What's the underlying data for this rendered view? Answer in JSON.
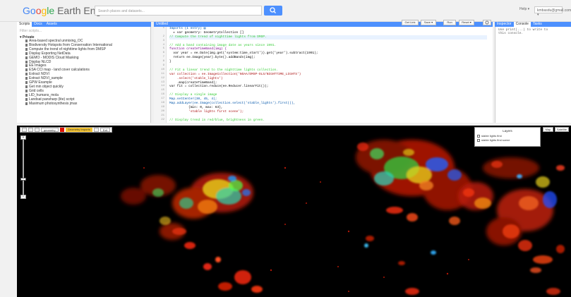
{
  "header": {
    "logo_g1": "Go",
    "logo_g2": "o",
    "logo_g3": "g",
    "logo_g4": "le",
    "logo_rest": " Earth Engine",
    "search_placeholder": "Search places and datasets...",
    "help": "Help ▾",
    "user": "kmbasdu@gmail.com ▾"
  },
  "left_panel": {
    "tabs": [
      "Scripts",
      "Docs",
      "Assets"
    ],
    "filter": "Filter scripts...",
    "folder": "▾ Private",
    "files": [
      "Area-based spectral unmixing_OC",
      "Biodiversity Hotspots from Conservation International",
      "Compute the trend of nighttime lights from DMSP",
      "Display Exporting NetData",
      "GEMO - MODIS Cloud Masking",
      "Display NLCD",
      "EE Images",
      "ESA CCI map - land cover calculations",
      "Extract NDVI",
      "Extract NDVI_sample",
      "GPW Example",
      "Get min object quickly",
      "Grid cells",
      "LID_humans_mola",
      "Landsat pansharp (lite) script",
      "Maximum photosynthesis jmax"
    ]
  },
  "editor": {
    "title": "Untitled",
    "buttons": [
      "Get Link",
      "Save ▾",
      "Run",
      "Reset ▾"
    ],
    "lines": [
      {
        "n": "1",
        "t": "Imports (1 entry) ▤",
        "c": "cb"
      },
      {
        "n": "",
        "t": "  ▸ var geometry: GeometryCollection []",
        "c": ""
      },
      {
        "n": "2",
        "t": "// Compute the trend of nighttime lights from DMSP.",
        "c": "cc",
        "hl": true
      },
      {
        "n": "3",
        "t": "",
        "c": ""
      },
      {
        "n": "4",
        "t": "// Add a band containing image date as years since 1991.",
        "c": "cc"
      },
      {
        "n": "5",
        "t": "function createTimeBand(img) {",
        "c": "cm"
      },
      {
        "n": "6",
        "t": "  var year = ee.Date(img.get('system:time_start')).get('year').subtract(1991);",
        "c": ""
      },
      {
        "n": "7",
        "t": "  return ee.Image(year).byte().addBands(img);",
        "c": ""
      },
      {
        "n": "8",
        "t": "}",
        "c": ""
      },
      {
        "n": "9",
        "t": "",
        "c": ""
      },
      {
        "n": "10",
        "t": "// Fit a linear trend to the nighttime lights collection.",
        "c": "cc"
      },
      {
        "n": "11",
        "t": "var collection = ee.ImageCollection('NOAA/DMSP-OLS/NIGHTTIME_LIGHTS')",
        "c": "ck"
      },
      {
        "n": "12",
        "t": "    .select('stable_lights')",
        "c": "ck"
      },
      {
        "n": "13",
        "t": "    .map(createTimeBand);",
        "c": ""
      },
      {
        "n": "14",
        "t": "var fit = collection.reduce(ee.Reducer.linearFit());",
        "c": ""
      },
      {
        "n": "15",
        "t": "",
        "c": ""
      },
      {
        "n": "16",
        "t": "// Display a single image",
        "c": "cc"
      },
      {
        "n": "17",
        "t": "Map.setCenter(30, 45, 4);",
        "c": "cb"
      },
      {
        "n": "18",
        "t": "Map.addLayer(ee.Image(collection.select('stable_lights').first()),",
        "c": "cb"
      },
      {
        "n": "19",
        "t": "          {min: 0, max: 63},",
        "c": ""
      },
      {
        "n": "20",
        "t": "          'stable lights first scene');",
        "c": "ck"
      },
      {
        "n": "21",
        "t": "",
        "c": ""
      },
      {
        "n": "22",
        "t": "// Display trend in red/blue, brightness in green.",
        "c": "cc"
      }
    ]
  },
  "right_panel": {
    "tabs": [
      "Inspector",
      "Console",
      "Tasks"
    ],
    "text_1": "Use print(...) to write to",
    "text_2": "this console."
  },
  "map": {
    "toolbar": {
      "geometry": "geometry",
      "layer": "Geometry Imports",
      "edit": "Exit"
    },
    "zoom_plus": "+",
    "zoom_minus": "−",
    "layers_title": "Layers",
    "layers": [
      "stable lights first",
      "stable lights first scene"
    ],
    "map_type": [
      "Map",
      "Satellite"
    ]
  }
}
